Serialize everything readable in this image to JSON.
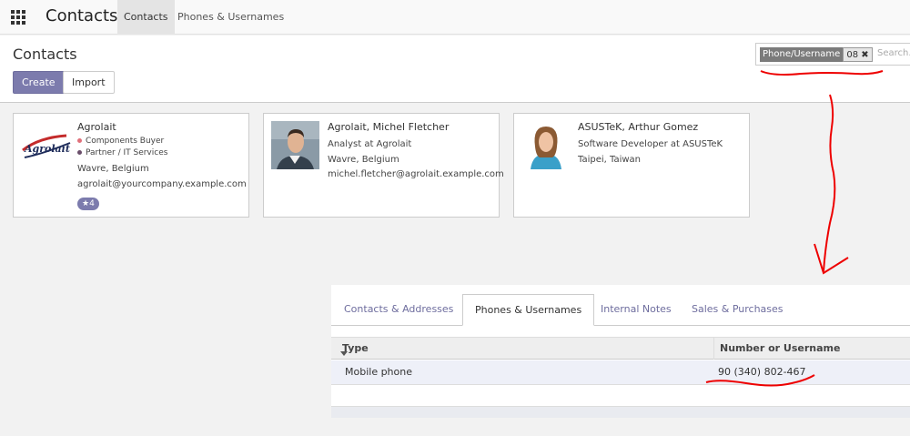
{
  "app": {
    "title": "Contacts",
    "menu": [
      "Contacts",
      "Phones & Usernames"
    ]
  },
  "control_panel": {
    "breadcrumb": "Contacts",
    "create_label": "Create",
    "import_label": "Import",
    "search": {
      "facet_category": "Phone/Username",
      "facet_value": "08",
      "facet_remove": "✖",
      "placeholder": "Search..."
    }
  },
  "cards": [
    {
      "name": "Agrolait",
      "logo_text": "Agrolait",
      "tags": [
        {
          "label": "Components Buyer",
          "color": "#e0707a"
        },
        {
          "label": "Partner / IT Services",
          "color": "#6b4f6b"
        }
      ],
      "location": "Wavre, Belgium",
      "email": "agrolait@yourcompany.example.com",
      "badge_icon": "★",
      "badge_count": "4"
    },
    {
      "name": "Agrolait, Michel Fletcher",
      "function": "Analyst at Agrolait",
      "location": "Wavre, Belgium",
      "email": "michel.fletcher@agrolait.example.com"
    },
    {
      "name": "ASUSTeK, Arthur Gomez",
      "function": "Software Developer at ASUSTeK",
      "location": "Taipei, Taiwan"
    }
  ],
  "form": {
    "tabs": [
      "Contacts & Addresses",
      "Phones & Usernames",
      "Internal Notes",
      "Sales & Purchases"
    ],
    "active_tab": "Phones & Usernames",
    "table": {
      "headers": [
        "Type",
        "Number or Username"
      ],
      "rows": [
        {
          "type": "Mobile phone",
          "number": "90 (340) 802-467"
        }
      ]
    }
  },
  "colors": {
    "primary": "#7c7bad",
    "annotation": "#ee0000"
  }
}
